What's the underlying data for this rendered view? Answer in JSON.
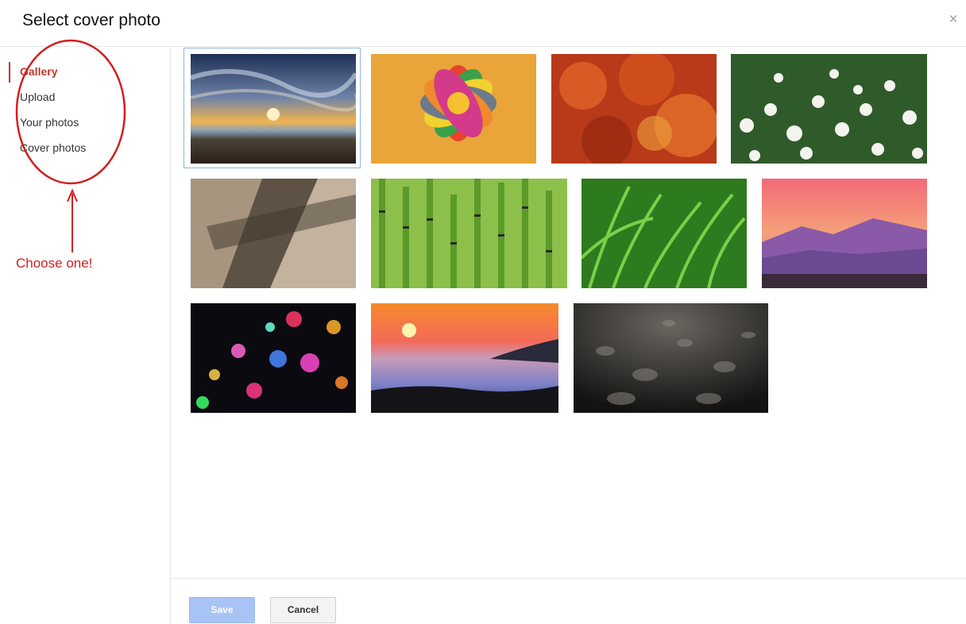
{
  "dialog": {
    "title": "Select cover photo",
    "close_label": "×"
  },
  "sidebar": {
    "items": [
      {
        "label": "Gallery",
        "active": true
      },
      {
        "label": "Upload",
        "active": false
      },
      {
        "label": "Your photos",
        "active": false
      },
      {
        "label": "Cover photos",
        "active": false
      }
    ]
  },
  "annotation": {
    "note": "Choose one!",
    "color": "#d21f1f"
  },
  "gallery": {
    "photos": [
      {
        "name": "beach-sunset-photo",
        "selected": true
      },
      {
        "name": "colorful-petals-photo",
        "selected": false
      },
      {
        "name": "red-maple-leaves-photo",
        "selected": false
      },
      {
        "name": "white-daisies-photo",
        "selected": false
      },
      {
        "name": "abstract-folds-photo",
        "selected": false
      },
      {
        "name": "horsetail-plants-photo",
        "selected": false
      },
      {
        "name": "green-grass-photo",
        "selected": false
      },
      {
        "name": "pink-mountains-photo",
        "selected": false
      },
      {
        "name": "bokeh-lights-photo",
        "selected": false
      },
      {
        "name": "sea-of-clouds-sunset-photo",
        "selected": false
      },
      {
        "name": "water-droplets-photo",
        "selected": false
      }
    ]
  },
  "footer": {
    "save_label": "Save",
    "cancel_label": "Cancel"
  },
  "colors": {
    "accent": "#c0392b",
    "save_disabled": "#a8c3f5",
    "selection_border": "#8fb8de"
  }
}
